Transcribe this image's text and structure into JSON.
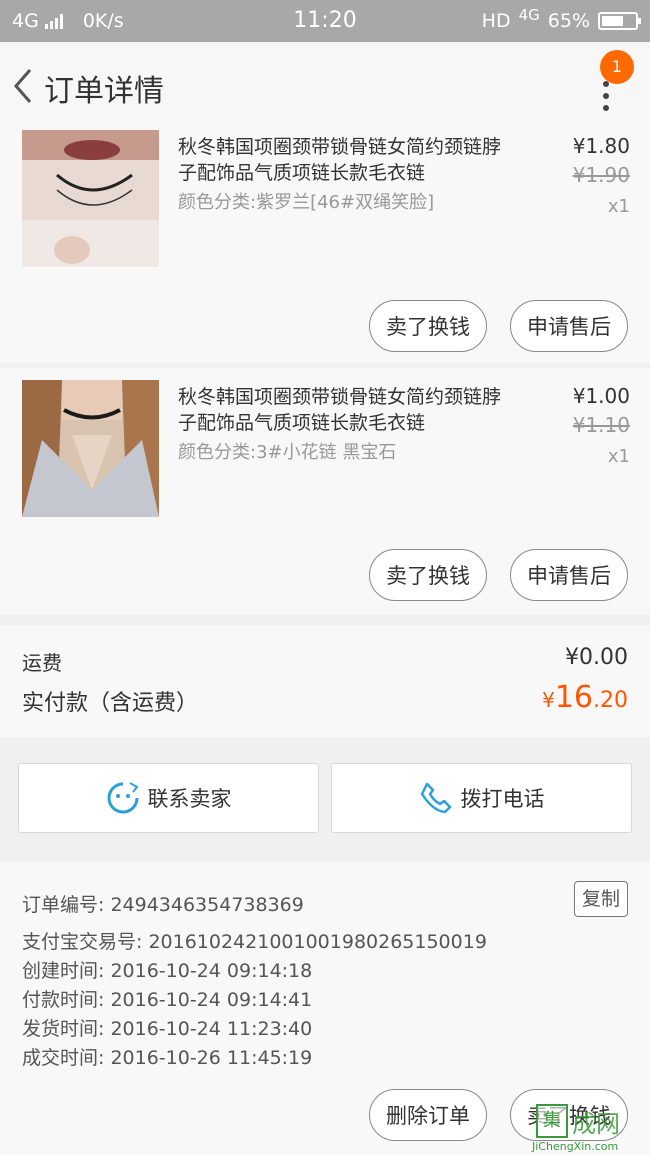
{
  "status_bar": {
    "network": "4G",
    "speed": "0K/s",
    "time": "11:20",
    "hd": "HD",
    "network_right": "4G",
    "battery": "65%",
    "battery_level": 0.65
  },
  "header": {
    "title": "订单详情",
    "badge_count": "1"
  },
  "items": [
    {
      "title": "秋冬韩国项圈颈带锁骨链女简约颈链脖子配饰品气质项链长款毛衣链",
      "sku": "颜色分类:紫罗兰[46#双绳笑脸]",
      "price": "¥1.80",
      "original_price": "¥1.90",
      "quantity": "x1",
      "actions": [
        "卖了换钱",
        "申请售后"
      ]
    },
    {
      "title": "秋冬韩国项圈颈带锁骨链女简约颈链脖子配饰品气质项链长款毛衣链",
      "sku": "颜色分类:3#小花链 黑宝石",
      "price": "¥1.00",
      "original_price": "¥1.10",
      "quantity": "x1",
      "actions": [
        "卖了换钱",
        "申请售后"
      ]
    }
  ],
  "fees": {
    "shipping_label": "运费",
    "shipping_value": "¥0.00",
    "total_label": "实付款（含运费）",
    "total_currency": "¥",
    "total_integer": "16",
    "total_decimal": ".20"
  },
  "contact": {
    "seller_label": "联系卖家",
    "call_label": "拨打电话"
  },
  "order_info": {
    "order_number": "订单编号: 2494346354738369",
    "copy_label": "复制",
    "alipay_number": "支付宝交易号: 2016102421001001980265150019",
    "created": "创建时间: 2016-10-24 09:14:18",
    "paid": "付款时间: 2016-10-24 09:14:41",
    "shipped": "发货时间: 2016-10-24 11:23:40",
    "completed": "成交时间: 2016-10-26 11:45:19"
  },
  "bottom_actions": {
    "delete_label": "删除订单",
    "sell_label": "卖了换钱"
  },
  "watermark": {
    "box": "集",
    "text": "成网",
    "url": "JiChengXin.com"
  }
}
